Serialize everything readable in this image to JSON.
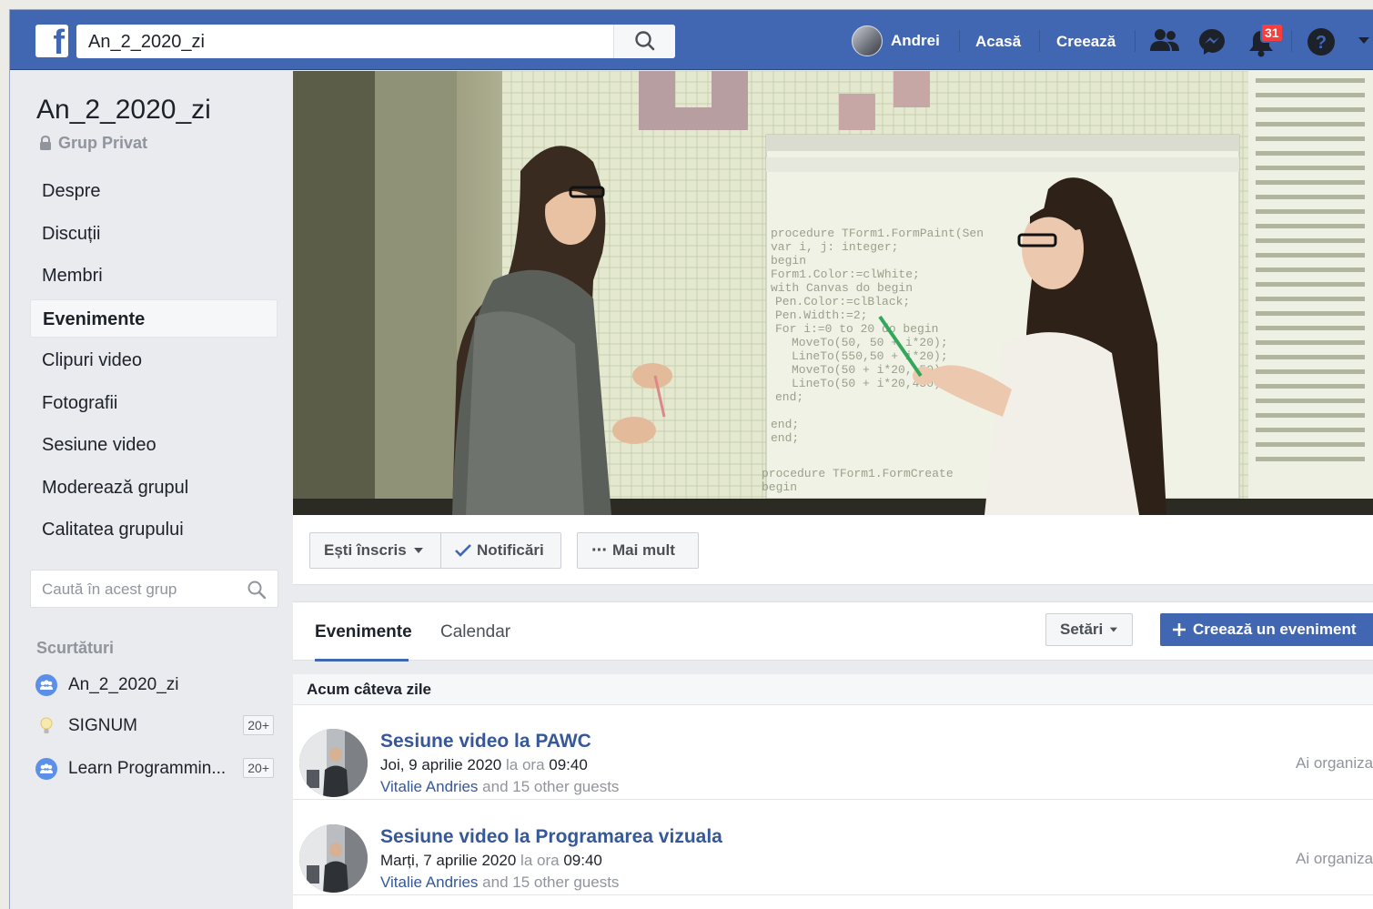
{
  "topbar": {
    "search_value": "An_2_2020_zi",
    "user_name": "Andrei",
    "home": "Acasă",
    "create": "Creează",
    "notification_count": "31"
  },
  "group": {
    "title": "An_2_2020_zi",
    "privacy": "Grup Privat"
  },
  "menu": [
    {
      "label": "Despre"
    },
    {
      "label": "Discuții"
    },
    {
      "label": "Membri"
    },
    {
      "label": "Evenimente"
    },
    {
      "label": "Clipuri video"
    },
    {
      "label": "Fotografii"
    },
    {
      "label": "Sesiune video"
    },
    {
      "label": "Moderează grupul"
    },
    {
      "label": "Calitatea grupului"
    }
  ],
  "group_search": {
    "placeholder": "Caută în acest grup"
  },
  "shortcuts": {
    "heading": "Scurtături",
    "items": [
      {
        "label": "An_2_2020_zi",
        "badge": ""
      },
      {
        "label": "SIGNUM",
        "badge": "20+"
      },
      {
        "label": "Learn Programmin...",
        "badge": "20+"
      }
    ]
  },
  "actions": {
    "joined": "Ești înscris",
    "notifications": "Notificări",
    "more": "Mai mult"
  },
  "events_panel": {
    "tab_events": "Evenimente",
    "tab_calendar": "Calendar",
    "settings": "Setări",
    "create_event": "Creează un eveniment",
    "section": "Acum câteva zile",
    "items": [
      {
        "title": "Sesiune video la PAWC",
        "day": "Joi, 9 aprilie 2020",
        "at": "la ora",
        "time": "09:40",
        "host": "Vitalie Andries",
        "guests": "and 15 other guests",
        "status": "Ai organizat"
      },
      {
        "title": "Sesiune video la Programarea vizuala",
        "day": "Marți, 7 aprilie 2020",
        "at": "la ora",
        "time": "09:40",
        "host": "Vitalie Andries",
        "guests": "and 15 other guests",
        "status": "Ai organizat"
      }
    ]
  },
  "colors": {
    "topbar": "#4267b2",
    "link": "#365899",
    "create_button": "#4267b2",
    "notification_badge": "#fa3e3e"
  }
}
